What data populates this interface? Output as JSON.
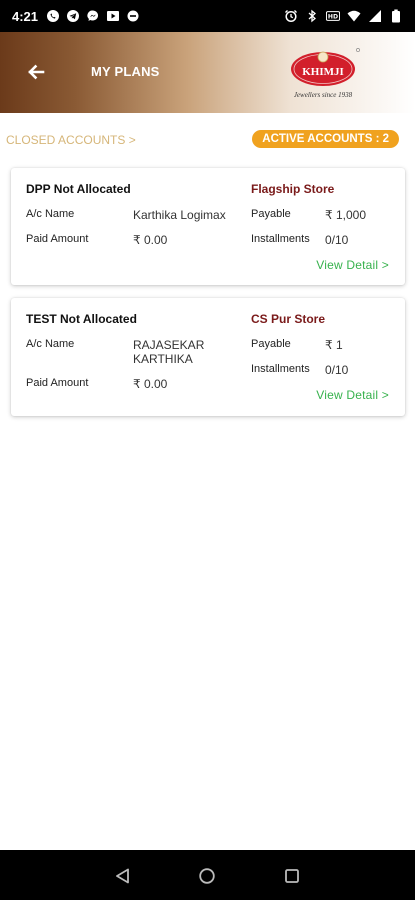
{
  "status_bar": {
    "time": "4:21"
  },
  "header": {
    "title": "MY PLANS",
    "logo_text": "KHIMJI",
    "logo_tagline": "Jewellers since 1938"
  },
  "tabs": {
    "closed_label": "CLOSED ACCOUNTS >",
    "active_label": "ACTIVE ACCOUNTS : 2"
  },
  "labels": {
    "ac_name": "A/c Name",
    "paid_amount": "Paid Amount",
    "payable": "Payable",
    "installments": "Installments",
    "view_detail": "View Detail >"
  },
  "accounts": [
    {
      "scheme": "DPP Not Allocated",
      "store": "Flagship Store",
      "ac_name": "Karthika Logimax",
      "paid_amount": "₹ 0.00",
      "payable": "₹ 1,000",
      "installments": "0/10"
    },
    {
      "scheme": "TEST Not Allocated",
      "store": "CS Pur Store",
      "ac_name_line1": "RAJASEKAR",
      "ac_name_line2": "KARTHIKA",
      "paid_amount": "₹ 0.00",
      "payable": "₹ 1",
      "installments": "0/10"
    }
  ],
  "colors": {
    "header_brown": "#6b3a1a",
    "active_badge": "#f0a21f",
    "closed_text": "#d6b679",
    "store_text": "#7a1a1a",
    "view_detail": "#37b24d"
  },
  "icons": [
    "whatsapp-icon",
    "telegram-icon",
    "messenger-icon",
    "tv-icon",
    "minus-circle-icon",
    "alarm-icon",
    "bluetooth-icon",
    "hd-icon",
    "wifi-icon",
    "signal-icon",
    "battery-icon",
    "back-arrow-icon",
    "nav-back-icon",
    "nav-home-icon",
    "nav-recents-icon"
  ]
}
